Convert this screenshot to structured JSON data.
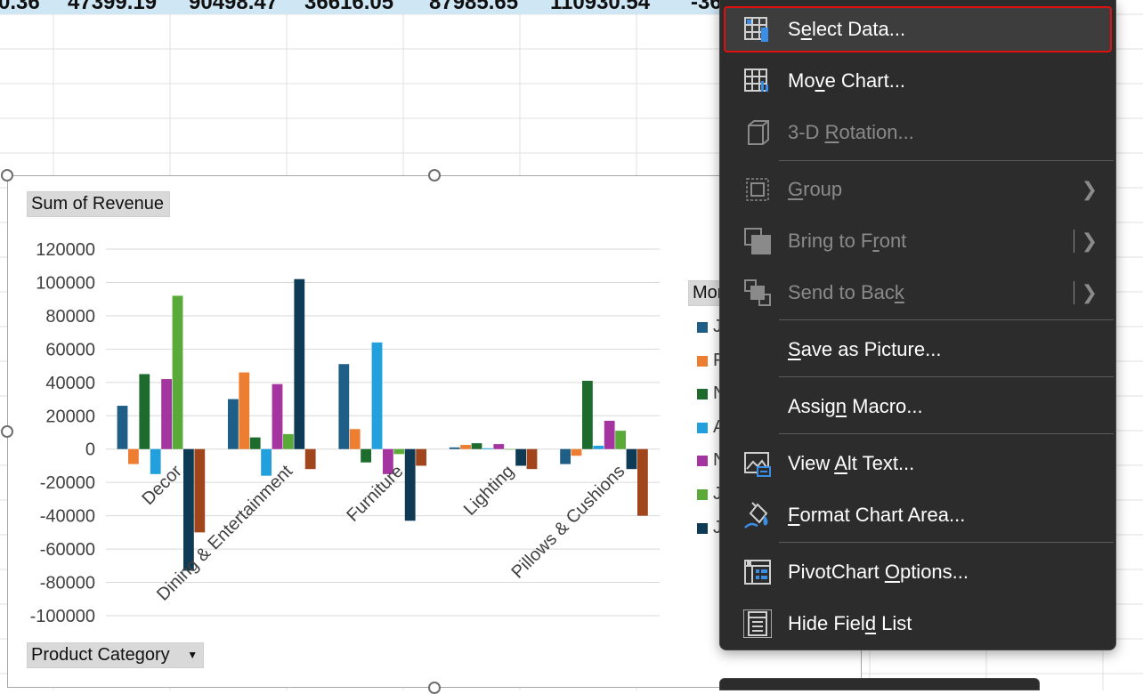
{
  "spreadsheet": {
    "top_row_values": [
      "0.36",
      "47399.19",
      "90498.47",
      "36616.05",
      "87985.65",
      "110930.54",
      "-36"
    ]
  },
  "chart_fields": {
    "value_field": "Sum of Revenue",
    "axis_field": "Product Category",
    "legend_field": "Mor",
    "legend_items": [
      "J",
      "F",
      "N",
      "A",
      "N",
      "J",
      "J"
    ]
  },
  "chart_data": {
    "type": "bar",
    "categories": [
      "Decor",
      "Dining & Entertainment",
      "Furniture",
      "Lighting",
      "Pillows & Cushions"
    ],
    "ylim": [
      -100000,
      120000
    ],
    "yticks": [
      "120000",
      "100000",
      "80000",
      "60000",
      "40000",
      "20000",
      "0",
      "-20000",
      "-40000",
      "-60000",
      "-80000",
      "-100000"
    ],
    "grid": true,
    "legend_position": "right",
    "series": [
      {
        "color": "#1f5f87",
        "values": [
          26000,
          30000,
          51000,
          1000,
          -9000
        ]
      },
      {
        "color": "#ed7d31",
        "values": [
          -9000,
          46000,
          12000,
          2500,
          -4000
        ]
      },
      {
        "color": "#1e6b2e",
        "values": [
          45000,
          7000,
          -8000,
          3500,
          41000
        ]
      },
      {
        "color": "#22a0dd",
        "values": [
          -15000,
          -16000,
          64000,
          500,
          2000
        ]
      },
      {
        "color": "#a334a0",
        "values": [
          42000,
          39000,
          -15000,
          3000,
          17000
        ]
      },
      {
        "color": "#5aaa3a",
        "values": [
          92000,
          9000,
          -3000,
          0,
          11000
        ]
      },
      {
        "color": "#0f3a55",
        "values": [
          -73000,
          102000,
          -43000,
          -10000,
          -12000
        ]
      },
      {
        "color": "#a0451c",
        "values": [
          -50000,
          -12000,
          -10000,
          -12000,
          -40000
        ]
      }
    ]
  },
  "context_menu": {
    "items": [
      {
        "label": "Select Data...",
        "disabled": false,
        "icon": "select-data-icon"
      },
      {
        "label": "Move Chart...",
        "disabled": false,
        "icon": "move-chart-icon"
      },
      {
        "label": "3-D Rotation...",
        "disabled": true,
        "icon": "3d-rotation-icon"
      },
      {
        "label": "Group",
        "disabled": true,
        "icon": "group-icon"
      },
      {
        "label": "Bring to Front",
        "disabled": true,
        "icon": "bring-to-front-icon"
      },
      {
        "label": "Send to Back",
        "disabled": true,
        "icon": "send-to-back-icon"
      },
      {
        "label": "Save as Picture...",
        "disabled": false,
        "icon": ""
      },
      {
        "label": "Assign Macro...",
        "disabled": false,
        "icon": ""
      },
      {
        "label": "View Alt Text...",
        "disabled": false,
        "icon": "alt-text-icon"
      },
      {
        "label": "Format Chart Area...",
        "disabled": false,
        "icon": "format-chart-area-icon"
      },
      {
        "label": "PivotChart Options...",
        "disabled": false,
        "icon": "pivotchart-options-icon"
      },
      {
        "label": "Hide Field List",
        "disabled": false,
        "icon": "field-list-icon"
      }
    ]
  },
  "colors": {
    "menu_background": "#2c2c2c",
    "highlight_outline": "#e01010",
    "top_row_fill": "#cfe6f5"
  }
}
